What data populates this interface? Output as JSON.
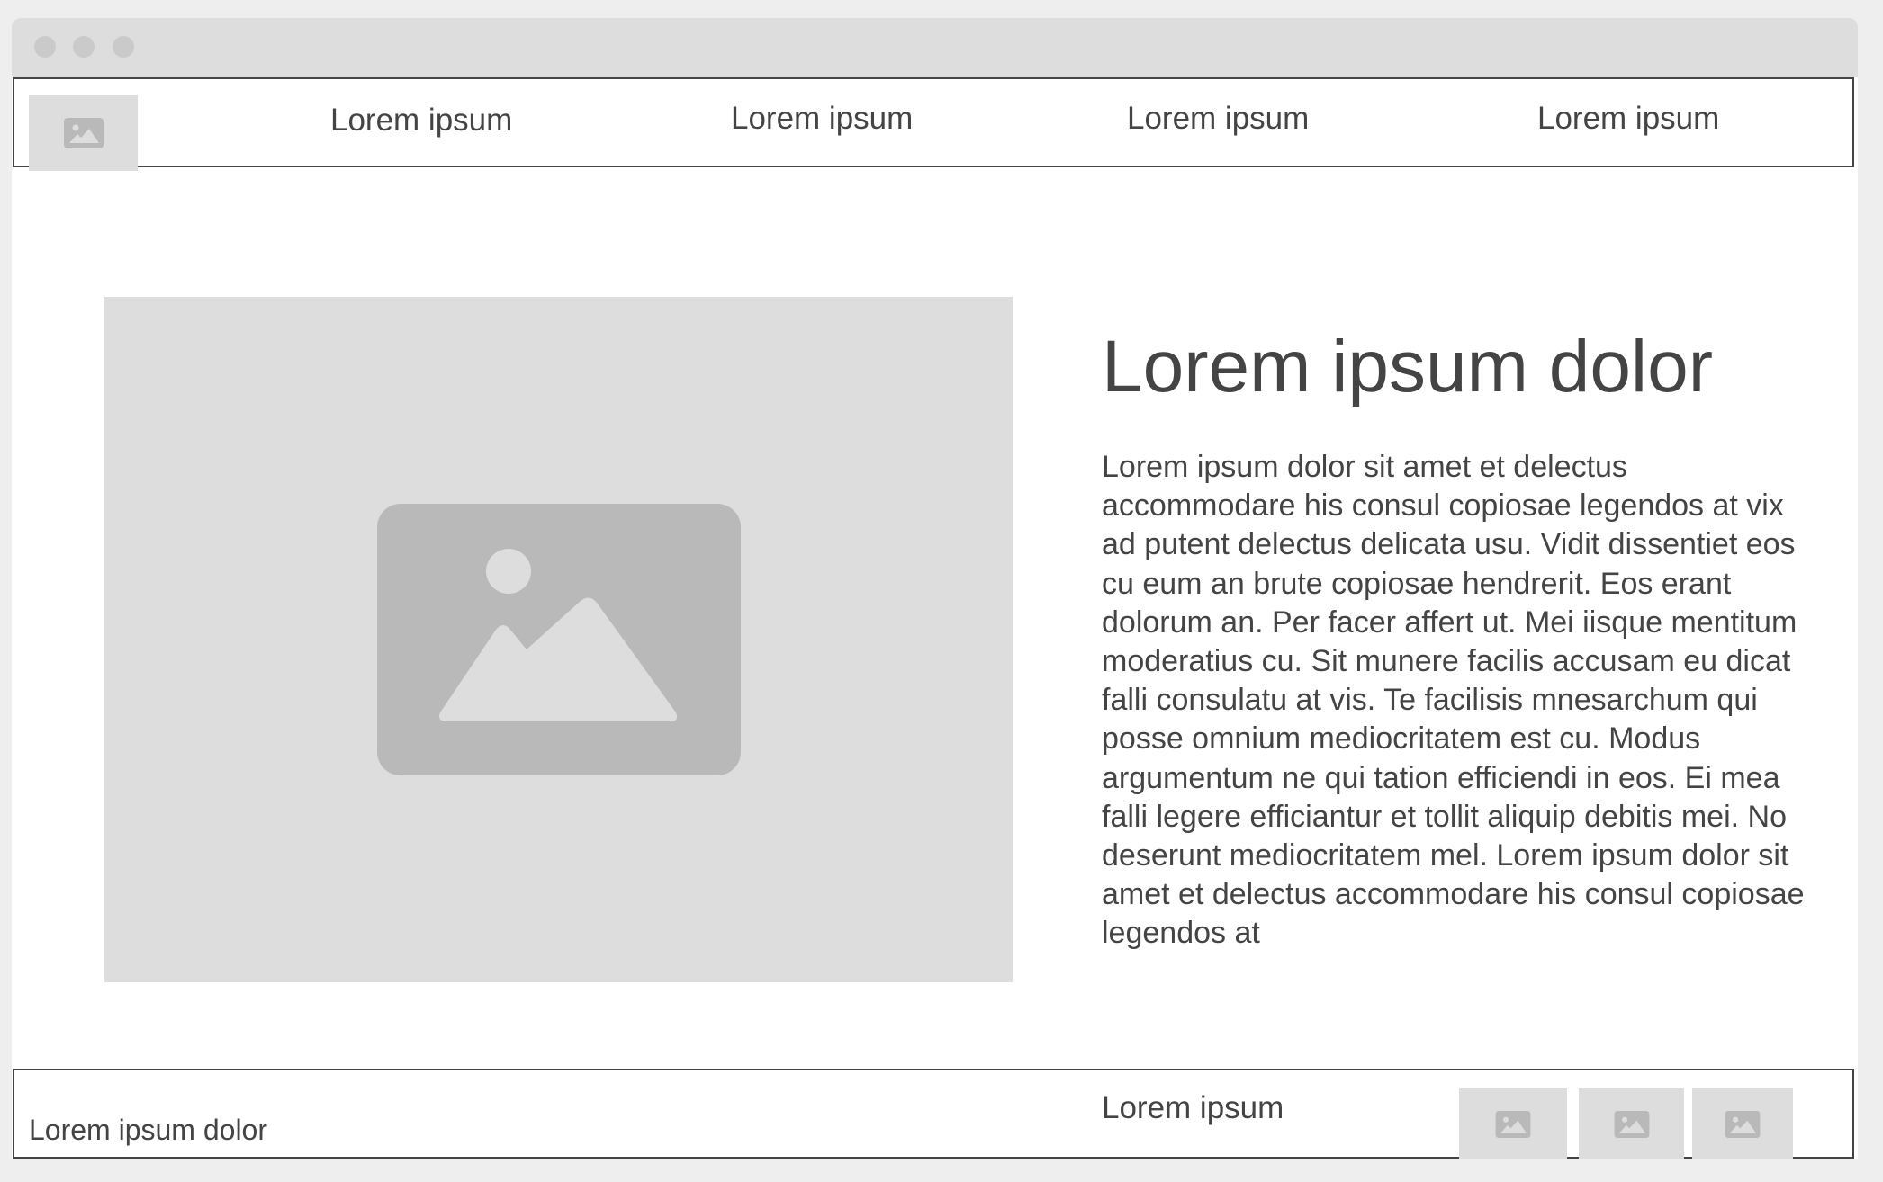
{
  "window": {
    "controls": [
      "close",
      "minimize",
      "maximize"
    ]
  },
  "nav": {
    "logo_icon": "image-placeholder-icon",
    "items": [
      {
        "label": "Lorem ipsum"
      },
      {
        "label": "Lorem ipsum"
      },
      {
        "label": "Lorem ipsum"
      },
      {
        "label": "Lorem ipsum"
      }
    ]
  },
  "hero": {
    "image_icon": "image-placeholder-icon",
    "headline": "Lorem ipsum dolor",
    "body": "Lorem ipsum dolor sit amet et delectus accommodare his consul copiosae legendos at vix ad putent delectus delicata usu. Vidit dissentiet eos cu eum an brute copiosae hendrerit. Eos erant dolorum an. Per facer affert ut. Mei iisque mentitum moderatius cu. Sit munere facilis accusam eu dicat falli consulatu at vis. Te facilisis mnesarchum qui posse omnium mediocritatem est cu. Modus argumentum ne qui tation efficiendi in eos. Ei mea falli legere efficiantur et tollit aliquip debitis mei. No deserunt mediocritatem mel. Lorem ipsum dolor sit amet et delectus accommodare his consul copiosae legendos at"
  },
  "footer": {
    "left_text": "Lorem ipsum dolor",
    "link": "Lorem ipsum",
    "social_icons": [
      "image-placeholder-icon",
      "image-placeholder-icon",
      "image-placeholder-icon"
    ]
  },
  "colors": {
    "placeholder_bg": "#dddddd",
    "placeholder_icon": "#b9b9b9",
    "text": "#444444",
    "border": "#444444",
    "page_bg": "#eeeeee"
  }
}
